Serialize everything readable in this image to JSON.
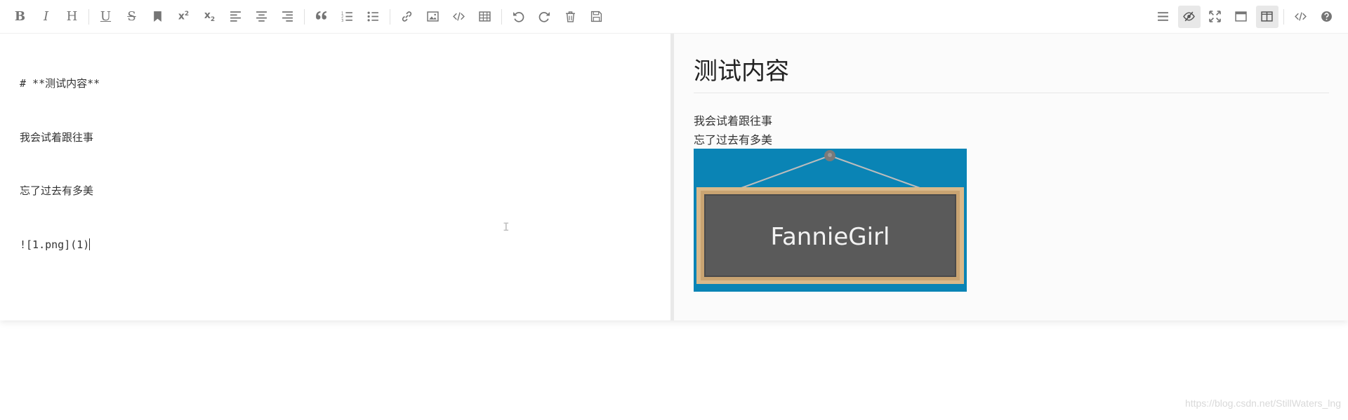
{
  "toolbar": {
    "left_icons": [
      "bold-icon",
      "italic-icon",
      "heading-icon",
      "underline-icon",
      "strikethrough-icon",
      "bookmark-icon",
      "superscript-icon",
      "subscript-icon",
      "align-left-icon",
      "align-center-icon",
      "align-right-icon",
      "quote-icon",
      "ordered-list-icon",
      "unordered-list-icon",
      "link-icon",
      "image-icon",
      "code-icon",
      "table-icon",
      "undo-icon",
      "redo-icon",
      "trash-icon",
      "save-icon"
    ],
    "right_icons": [
      "navigation-icon",
      "preview-eye-icon",
      "fullscreen-icon",
      "read-mode-icon",
      "subfield-icon",
      "html-code-icon",
      "help-icon"
    ],
    "labels": {
      "bold": "B",
      "italic": "I",
      "heading": "H",
      "underline": "U",
      "strikethrough": "S",
      "superscript": "x",
      "subscript": "x"
    }
  },
  "editor": {
    "lines": [
      "# **测试内容**",
      "我会试着跟往事",
      "忘了过去有多美",
      "![1.png](1)"
    ]
  },
  "preview": {
    "heading": "测试内容",
    "paragraphs": [
      "我会试着跟往事",
      "忘了过去有多美"
    ],
    "image_text": "FannieGirl"
  },
  "watermark": "https://blog.csdn.net/StillWaters_lng",
  "colors": {
    "icon": "#757575",
    "active_bg": "#e8e8e8",
    "preview_bg": "#fbfbfb",
    "image_bg": "#0a84b5",
    "board": "#5a5a5a",
    "frame": "#d9b98a"
  }
}
